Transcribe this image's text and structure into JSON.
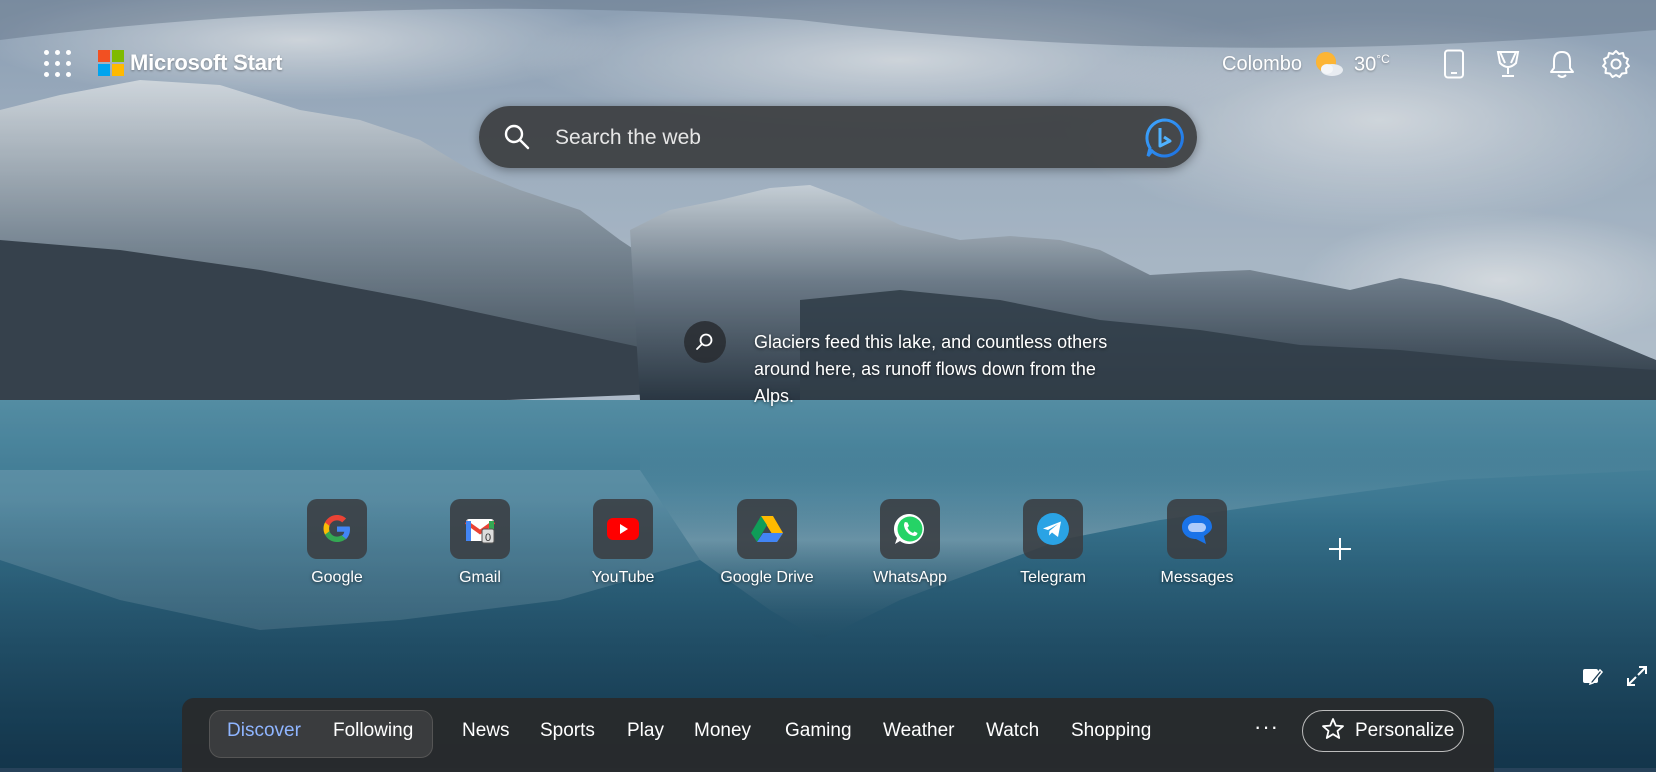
{
  "header": {
    "brand": "Microsoft Start",
    "weather": {
      "city": "Colombo",
      "temperature": "30",
      "unit": "°C"
    },
    "icons": [
      "apps-grid-icon",
      "mobile-phone-icon",
      "rewards-trophy-icon",
      "bell-icon",
      "gear-icon"
    ]
  },
  "search": {
    "placeholder": "Search the web"
  },
  "image_caption": "Glaciers feed this lake, and countless others around here, as runoff flows down from the Alps.",
  "quick_links": [
    {
      "label": "Google",
      "icon": "google-icon"
    },
    {
      "label": "Gmail",
      "icon": "gmail-icon"
    },
    {
      "label": "YouTube",
      "icon": "youtube-icon"
    },
    {
      "label": "Google Drive",
      "icon": "google-drive-icon"
    },
    {
      "label": "WhatsApp",
      "icon": "whatsapp-icon"
    },
    {
      "label": "Telegram",
      "icon": "telegram-icon"
    },
    {
      "label": "Messages",
      "icon": "messages-icon"
    }
  ],
  "nav": {
    "segment": [
      "Discover",
      "Following"
    ],
    "active": "Discover",
    "items": [
      "News",
      "Sports",
      "Play",
      "Money",
      "Gaming",
      "Weather",
      "Watch",
      "Shopping"
    ],
    "more": "···",
    "personalize": "Personalize"
  },
  "colors": {
    "accent_active": "#8fb5ff",
    "nav_background": "#282a2c",
    "search_background": "#3c3e40",
    "ms_red": "#f25022",
    "ms_green": "#7fba00",
    "ms_blue": "#00a4ef",
    "ms_yellow": "#ffb900"
  }
}
